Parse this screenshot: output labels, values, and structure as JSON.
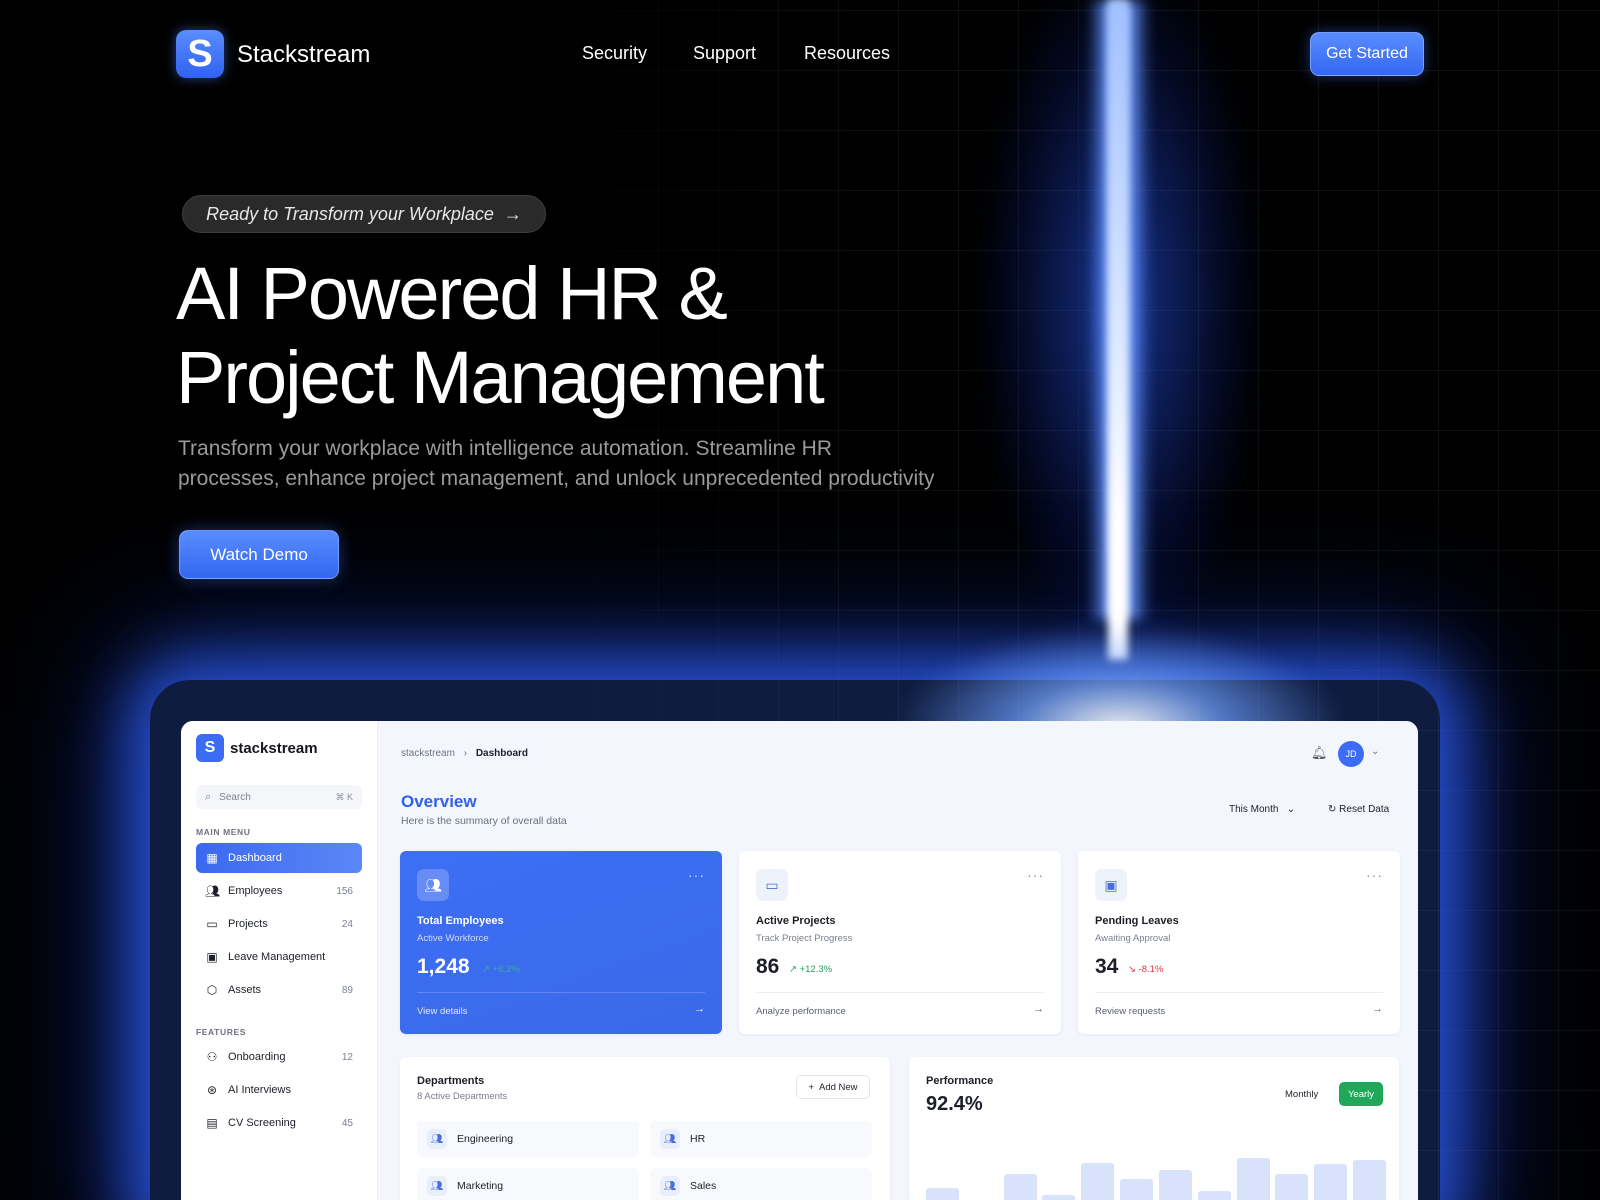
{
  "brand": {
    "name": "Stackstream",
    "mark": "S"
  },
  "nav": {
    "links": [
      "Security",
      "Support",
      "Resources"
    ],
    "cta": "Get Started"
  },
  "hero": {
    "pill": "Ready to Transform your Workplace",
    "pill_arrow": "→",
    "title_line1": "AI Powered HR &",
    "title_line2": "Project Management",
    "subtitle_line1": "Transform your workplace with intelligence automation. Streamline HR",
    "subtitle_line2": "processes, enhance project management, and unlock unprecedented productivity",
    "cta": "Watch Demo"
  },
  "dashboard": {
    "sidebar": {
      "logo_mark": "S",
      "title": "stackstream",
      "search_placeholder": "Search",
      "search_shortcut": "⌘ K",
      "main_menu_label": "MAIN MENU",
      "main_items": [
        {
          "label": "Dashboard",
          "count": "",
          "icon": "dashboard-icon",
          "active": true
        },
        {
          "label": "Employees",
          "count": "156",
          "icon": "users-icon"
        },
        {
          "label": "Projects",
          "count": "24",
          "icon": "folder-icon"
        },
        {
          "label": "Leave Management",
          "count": "",
          "icon": "calendar-icon"
        },
        {
          "label": "Assets",
          "count": "89",
          "icon": "box-icon"
        }
      ],
      "features_label": "FEATURES",
      "feature_items": [
        {
          "label": "Onboarding",
          "count": "12",
          "icon": "user-plus-icon"
        },
        {
          "label": "AI Interviews",
          "count": "",
          "icon": "ai-icon"
        },
        {
          "label": "CV Screening",
          "count": "45",
          "icon": "document-icon"
        }
      ]
    },
    "header": {
      "breadcrumb_root": "stackstream",
      "breadcrumb_sep": "›",
      "breadcrumb_current": "Dashboard",
      "avatar": "JD"
    },
    "overview": {
      "title": "Overview",
      "subtitle": "Here is the summary of overall data",
      "period": "This Month",
      "reset": "Reset Data"
    },
    "stats": [
      {
        "title": "Total Employees",
        "subtitle": "Active Workforce",
        "value": "1,248",
        "change": "↗ +8.2%",
        "trend": "up",
        "link": "View details",
        "style": "blue"
      },
      {
        "title": "Active Projects",
        "subtitle": "Track Project Progress",
        "value": "86",
        "change": "↗ +12.3%",
        "trend": "up",
        "link": "Analyze performance",
        "style": "white"
      },
      {
        "title": "Pending Leaves",
        "subtitle": "Awaiting Approval",
        "value": "34",
        "change": "↘ -8.1%",
        "trend": "down",
        "link": "Review requests",
        "style": "white"
      }
    ],
    "departments": {
      "title": "Departments",
      "subtitle": "8 Active Departments",
      "add_label": "Add New",
      "items": [
        "Engineering",
        "HR",
        "Marketing",
        "Sales"
      ]
    },
    "performance": {
      "title": "Performance",
      "value": "92.4%",
      "toggle_monthly": "Monthly",
      "toggle_yearly": "Yearly",
      "selected": "Yearly",
      "bar_levels": [
        0.55,
        0.38,
        0.75,
        0.45,
        0.92,
        0.68,
        0.82,
        0.52,
        0.98,
        0.75,
        0.9,
        0.95
      ]
    }
  }
}
